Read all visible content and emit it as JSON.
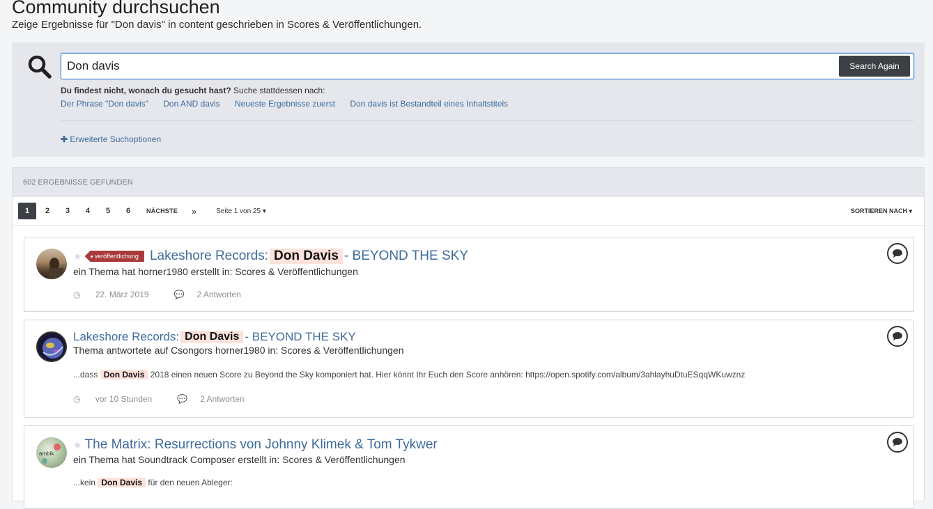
{
  "header": {
    "title": "Community durchsuchen",
    "subtitle": "Zeige Ergebnisse für \"Don davis\" in content geschrieben in Scores & Veröffentlichungen."
  },
  "search": {
    "value": "Don davis",
    "button_label": "Search Again",
    "hint_bold": "Du findest nicht, wonach du gesucht hast?",
    "hint_rest": " Suche stattdessen nach:",
    "alternatives": [
      "Der Phrase \"Don davis\"",
      "Don AND davis",
      "Neueste Ergebnisse zuerst",
      "Don davis ist Bestandteil eines Inhaltstitels"
    ],
    "advanced_label": "Erweiterte Suchoptionen"
  },
  "results": {
    "count_label": "602 ERGEBNISSE GEFUNDEN",
    "pages": [
      "1",
      "2",
      "3",
      "4",
      "5",
      "6"
    ],
    "next_label": "NÄCHSTE",
    "last_label": "»",
    "page_info": "Seite 1 von 25",
    "sort_label": "SORTIEREN NACH",
    "items": [
      {
        "badge": "veröffentlichung",
        "title_before": "Lakeshore Records:",
        "title_hl": "Don  Davis",
        "title_after": "- BEYOND THE SKY",
        "meta": "ein Thema hat horner1980 erstellt in: Scores & Veröffentlichungen",
        "date": "22. März 2019",
        "replies": "2 Antworten"
      },
      {
        "title_before": "Lakeshore Records:",
        "title_hl": "Don  Davis",
        "title_after": "- BEYOND THE SKY",
        "meta": "Thema antwortete auf Csongors horner1980 in: Scores & Veröffentlichungen",
        "snippet_before": "...dass",
        "snippet_hl": "Don  Davis",
        "snippet_after": "2018 einen neuen Score zu Beyond the Sky komponiert hat. Hier könnt Ihr Euch den Score anhören: https://open.spotify.com/album/3ahlayhuDtuESqqWKuwznz",
        "date": "vor 10 Stunden",
        "replies": "2 Antworten"
      },
      {
        "title": "The Matrix: Resurrections von Johnny Klimek & Tom Tykwer",
        "meta": "ein Thema hat Soundtrack Composer erstellt in: Scores & Veröffentlichungen",
        "snippet_before": "...kein",
        "snippet_hl": "Don  Davis",
        "snippet_after": "für den neuen Ableger:"
      }
    ]
  },
  "colors": {
    "link": "#3e6b9c",
    "highlight": "#fde2dc",
    "badge": "#a93a3a",
    "button": "#3d4146"
  }
}
